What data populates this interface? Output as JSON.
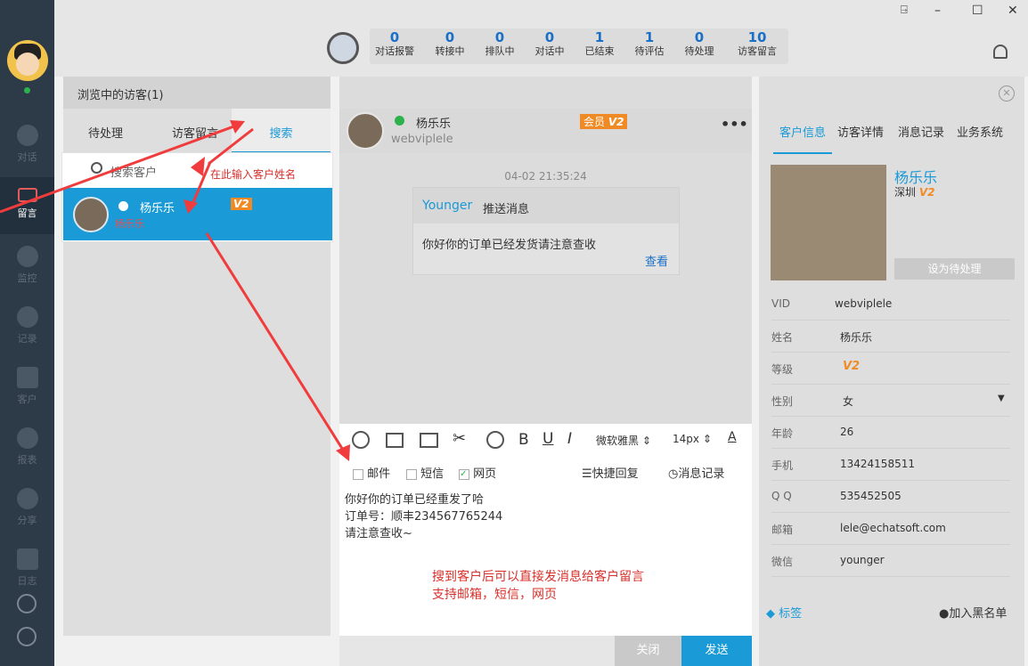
{
  "window_controls": {
    "pin": "⍈",
    "min": "–",
    "max": "☐",
    "close": "✕"
  },
  "nav": {
    "items": [
      {
        "label": "对话",
        "icon": "chat-icon"
      },
      {
        "label": "留言",
        "icon": "message-icon"
      },
      {
        "label": "监控",
        "icon": "eye-icon"
      },
      {
        "label": "记录",
        "icon": "clock-icon"
      },
      {
        "label": "客户",
        "icon": "customer-icon"
      },
      {
        "label": "报表",
        "icon": "chart-icon"
      },
      {
        "label": "分享",
        "icon": "share-icon"
      },
      {
        "label": "日志",
        "icon": "clipboard-icon"
      }
    ]
  },
  "stats": [
    {
      "n": "0",
      "l": "对话报警"
    },
    {
      "n": "0",
      "l": "转接中"
    },
    {
      "n": "0",
      "l": "排队中"
    },
    {
      "n": "0",
      "l": "对话中"
    },
    {
      "n": "1",
      "l": "已结束"
    },
    {
      "n": "1",
      "l": "待评估"
    },
    {
      "n": "0",
      "l": "待处理"
    },
    {
      "n": "10",
      "l": "访客留言"
    }
  ],
  "left_panel": {
    "title": "浏览中的访客(1)",
    "tabs": [
      "待处理",
      "访客留言",
      "搜索"
    ],
    "search_placeholder": "搜索客户",
    "visitor": {
      "name": "杨乐乐",
      "sub": "杨乐乐",
      "badge": "V2"
    }
  },
  "annotation_top": "在此输入客户姓名",
  "chat": {
    "name": "杨乐乐",
    "id": "webviplele",
    "member": "会员",
    "member_level": "V2",
    "time": "04-02 21:35:24",
    "msg_sender": "Younger",
    "msg_type": "推送消息",
    "msg_text": "你好你的订单已经发货请注意查收",
    "msg_link": "查看"
  },
  "composer": {
    "font": "微软雅黑",
    "size": "14px",
    "channels": [
      {
        "label": "邮件",
        "checked": false
      },
      {
        "label": "短信",
        "checked": false
      },
      {
        "label": "网页",
        "checked": true
      }
    ],
    "quick_reply": "快捷回复",
    "history": "消息记录",
    "lines": [
      "你好你的订单已经重发了哈",
      "订单号：顺丰234567765244",
      "请注意查收~"
    ],
    "note1": "搜到客户后可以直接发消息给客户留言",
    "note2": "支持邮箱，短信，网页",
    "close": "关闭",
    "send": "发送"
  },
  "right_panel": {
    "tabs": [
      "客户信息",
      "访客详情",
      "消息记录",
      "业务系统"
    ],
    "name": "杨乐乐",
    "city": "深圳",
    "level": "V2",
    "set_pending": "设为待处理",
    "fields": [
      {
        "k": "VID",
        "v": "webviplele"
      },
      {
        "k": "姓名",
        "v": "杨乐乐"
      },
      {
        "k": "等级",
        "v": "V2"
      },
      {
        "k": "性别",
        "v": "女"
      },
      {
        "k": "年龄",
        "v": "26"
      },
      {
        "k": "手机",
        "v": "13424158511"
      },
      {
        "k": "Q Q",
        "v": "535452505"
      },
      {
        "k": "邮箱",
        "v": "lele@echatsoft.com"
      },
      {
        "k": "微信",
        "v": "younger"
      }
    ],
    "tag": "标签",
    "blacklist": "加入黑名单"
  },
  "colors": {
    "accent": "#1a9ad6",
    "nav_bg": "#2d3a48",
    "orange": "#f08a24",
    "red_note": "#d9302b"
  }
}
